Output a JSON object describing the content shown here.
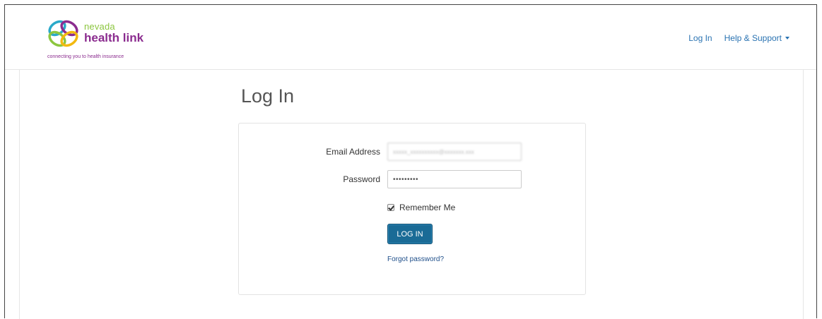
{
  "brand": {
    "name_line1": "nevada",
    "name_line2": "health link",
    "tagline": "connecting you to health insurance"
  },
  "nav": {
    "login": "Log In",
    "help": "Help & Support"
  },
  "page": {
    "title": "Log In"
  },
  "form": {
    "email_label": "Email Address",
    "email_value": "xxxxx_xxxxxxxxxx@xxxxxxx.xxx",
    "password_label": "Password",
    "password_value": "•••••••••",
    "remember_label": "Remember Me",
    "remember_checked": true,
    "submit_label": "LOG IN",
    "forgot_label": "Forgot password?"
  },
  "colors": {
    "brand_purple": "#8b2c8f",
    "brand_green": "#8cc63f",
    "link_blue": "#2a73b2",
    "button_blue": "#1a6b96"
  }
}
